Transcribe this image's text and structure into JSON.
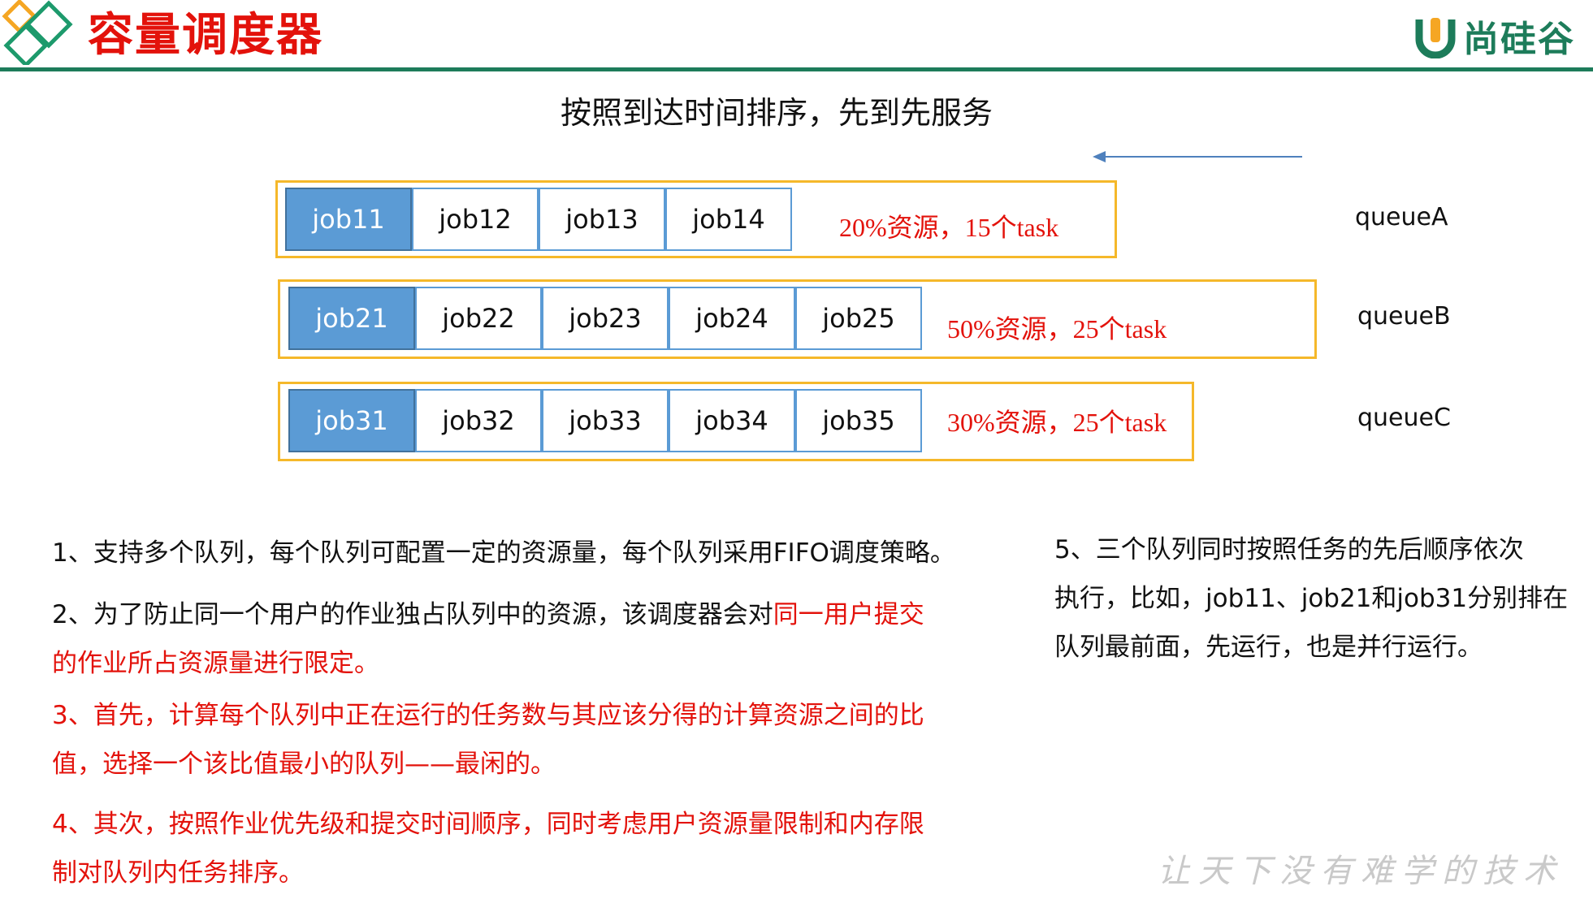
{
  "header": {
    "title": "容量调度器",
    "brand": "尚硅谷",
    "accent_color": "#1d7c5a",
    "title_color": "#e3120b"
  },
  "subtitle": "按照到达时间排序，先到先服务",
  "queues": [
    {
      "name": "queueA",
      "resource": "20%资源，15个task",
      "jobs": [
        "job11",
        "job12",
        "job13",
        "job14"
      ]
    },
    {
      "name": "queueB",
      "resource": "50%资源，25个task",
      "jobs": [
        "job21",
        "job22",
        "job23",
        "job24",
        "job25"
      ]
    },
    {
      "name": "queueC",
      "resource": "30%资源，25个task",
      "jobs": [
        "job31",
        "job32",
        "job33",
        "job34",
        "job35"
      ]
    }
  ],
  "points": {
    "p1": "1、支持多个队列，每个队列可配置一定的资源量，每个队列采用FIFO调度策略。",
    "p2_black": "2、为了防止同一个用户的作业独占队列中的资源，该调度器会对",
    "p2_red_a": "同一用户提交",
    "p2_red_b": "的作业所占资源量进行限定。",
    "p3_line1": "3、首先，计算每个队列中正在运行的任务数与其应该分得的计算资源之间的比",
    "p3_line2": "值，选择一个该比值最小的队列——最闲的。",
    "p4_line1": "4、其次，按照作业优先级和提交时间顺序，同时考虑用户资源量限制和内存限",
    "p4_line2": "制对队列内任务排序。",
    "p5_line1": "5、三个队列同时按照任务的先后顺序依次",
    "p5_line2": "执行，比如，job11、job21和job31分别排在",
    "p5_line3": "队列最前面，先运行，也是并行运行。"
  },
  "slogan": "让天下没有难学的技术"
}
